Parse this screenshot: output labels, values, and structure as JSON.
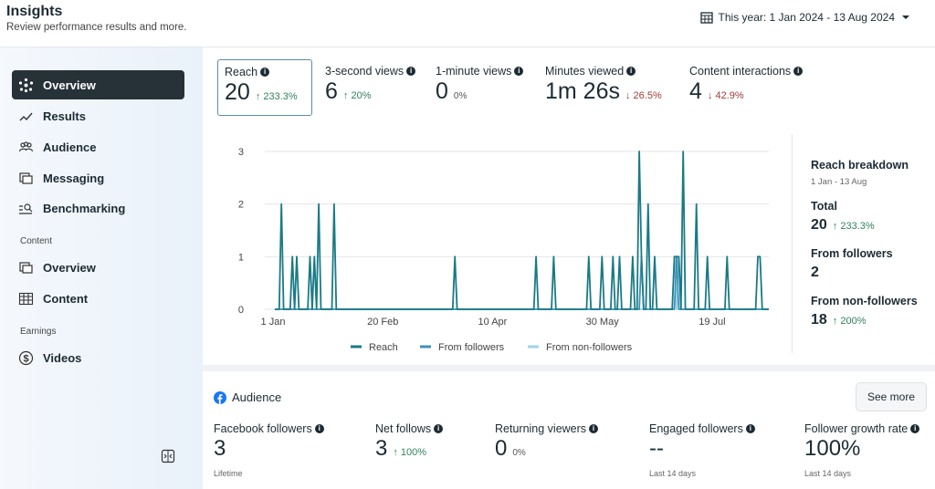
{
  "header": {
    "title": "Insights",
    "subtitle": "Review performance results and more.",
    "date_range": "This year: 1 Jan 2024 - 13 Aug 2024"
  },
  "sidebar": {
    "items": [
      {
        "label": "Overview",
        "icon": "overview-icon",
        "active": true
      },
      {
        "label": "Results",
        "icon": "results-icon"
      },
      {
        "label": "Audience",
        "icon": "audience-icon"
      },
      {
        "label": "Messaging",
        "icon": "messaging-icon"
      },
      {
        "label": "Benchmarking",
        "icon": "benchmarking-icon"
      }
    ],
    "content_section": "Content",
    "content_items": [
      {
        "label": "Overview",
        "icon": "content-overview-icon"
      },
      {
        "label": "Content",
        "icon": "table-icon"
      }
    ],
    "earnings_section": "Earnings",
    "earnings_items": [
      {
        "label": "Videos",
        "icon": "dollar-icon"
      }
    ]
  },
  "metrics": [
    {
      "label": "Reach",
      "value": "20",
      "change": "233.3%",
      "dir": "up"
    },
    {
      "label": "3-second views",
      "value": "6",
      "change": "20%",
      "dir": "up"
    },
    {
      "label": "1-minute views",
      "value": "0",
      "change": "0%",
      "dir": "none"
    },
    {
      "label": "Minutes viewed",
      "value": "1m 26s",
      "change": "26.5%",
      "dir": "down"
    },
    {
      "label": "Content interactions",
      "value": "4",
      "change": "42.9%",
      "dir": "down"
    }
  ],
  "breakdown": {
    "title": "Reach breakdown",
    "range": "1 Jan - 13 Aug",
    "total_label": "Total",
    "total": "20",
    "total_change": "233.3%",
    "followers_label": "From followers",
    "followers": "2",
    "nonfollowers_label": "From non-followers",
    "nonfollowers": "18",
    "nonfollowers_change": "200%"
  },
  "chart_data": {
    "type": "line",
    "x_range": [
      "2024-01-01",
      "2024-08-13"
    ],
    "ylim": [
      0,
      3
    ],
    "yticks": [
      0,
      1,
      2,
      3
    ],
    "xticks": [
      "1 Jan",
      "20 Feb",
      "10 Apr",
      "30 May",
      "19 Jul"
    ],
    "xtick_dates": [
      "2024-01-01",
      "2024-02-20",
      "2024-04-10",
      "2024-05-30",
      "2024-07-19"
    ],
    "grid": true,
    "legend_placement": "bottom",
    "series": [
      {
        "name": "Reach",
        "color": "#1a7a86",
        "points": [
          [
            "2024-01-04",
            2
          ],
          [
            "2024-01-09",
            1
          ],
          [
            "2024-01-11",
            1
          ],
          [
            "2024-01-17",
            1
          ],
          [
            "2024-01-19",
            1
          ],
          [
            "2024-01-21",
            2
          ],
          [
            "2024-01-28",
            2
          ],
          [
            "2024-03-23",
            1
          ],
          [
            "2024-04-29",
            1
          ],
          [
            "2024-05-07",
            1
          ],
          [
            "2024-05-23",
            1
          ],
          [
            "2024-05-29",
            1
          ],
          [
            "2024-06-03",
            1
          ],
          [
            "2024-06-06",
            1
          ],
          [
            "2024-06-12",
            1
          ],
          [
            "2024-06-15",
            3
          ],
          [
            "2024-06-16",
            1
          ],
          [
            "2024-06-19",
            2
          ],
          [
            "2024-06-22",
            1
          ],
          [
            "2024-07-01",
            1
          ],
          [
            "2024-07-02",
            1
          ],
          [
            "2024-07-03",
            1
          ],
          [
            "2024-07-05",
            3
          ],
          [
            "2024-07-11",
            2
          ],
          [
            "2024-07-16",
            1
          ],
          [
            "2024-07-25",
            1
          ],
          [
            "2024-08-08",
            1
          ],
          [
            "2024-08-09",
            1
          ]
        ]
      },
      {
        "name": "From followers",
        "color": "#3c93b8",
        "points": [
          [
            "2024-06-16",
            1
          ],
          [
            "2024-07-02",
            1
          ]
        ]
      },
      {
        "name": "From non-followers",
        "color": "#9fd3ea",
        "points": [
          [
            "2024-07-01",
            1
          ],
          [
            "2024-07-03",
            1
          ]
        ]
      }
    ]
  },
  "audience": {
    "title": "Audience",
    "see_more": "See more",
    "metrics": [
      {
        "label": "Facebook followers",
        "value": "3",
        "change": "",
        "dir": "none",
        "foot": "Lifetime"
      },
      {
        "label": "Net follows",
        "value": "3",
        "change": "100%",
        "dir": "up",
        "foot": ""
      },
      {
        "label": "Returning viewers",
        "value": "0",
        "change": "0%",
        "dir": "none",
        "foot": ""
      },
      {
        "label": "Engaged followers",
        "value": "--",
        "change": "",
        "dir": "none",
        "foot": "Last 14 days"
      },
      {
        "label": "Follower growth rate",
        "value": "100%",
        "change": "",
        "dir": "none",
        "foot": "Last 14 days"
      }
    ]
  }
}
